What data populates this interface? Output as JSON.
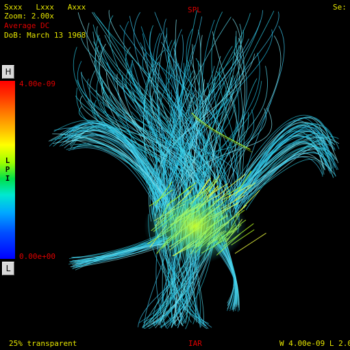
{
  "overlay": {
    "orientation": [
      "Sxxx",
      "Lxxx",
      "Axxx"
    ],
    "zoom": "Zoom: 2.00x",
    "mode": "Average DC",
    "dob": "DoB: March 13 1968",
    "top_center": "SPL",
    "top_right": "Se:",
    "bottom_left": "25% transparent",
    "bottom_center": "IAR",
    "bottom_right": "W 4.00e-09 L 2.0"
  },
  "colorbar": {
    "max_label": "4.00e-09",
    "min_label": "0.00e+00",
    "top_button": "H",
    "bottom_button": "L",
    "axis_letters": [
      "L",
      "P",
      "I"
    ],
    "colors": {
      "high": "#ff0000",
      "mid": "#ffff00",
      "low": "#0000ff"
    }
  },
  "colors": {
    "label_yellow": "#e6e600",
    "label_red": "#e00000",
    "fiber_cyan": "#2fd0e8",
    "fiber_green": "#b8ff20"
  }
}
